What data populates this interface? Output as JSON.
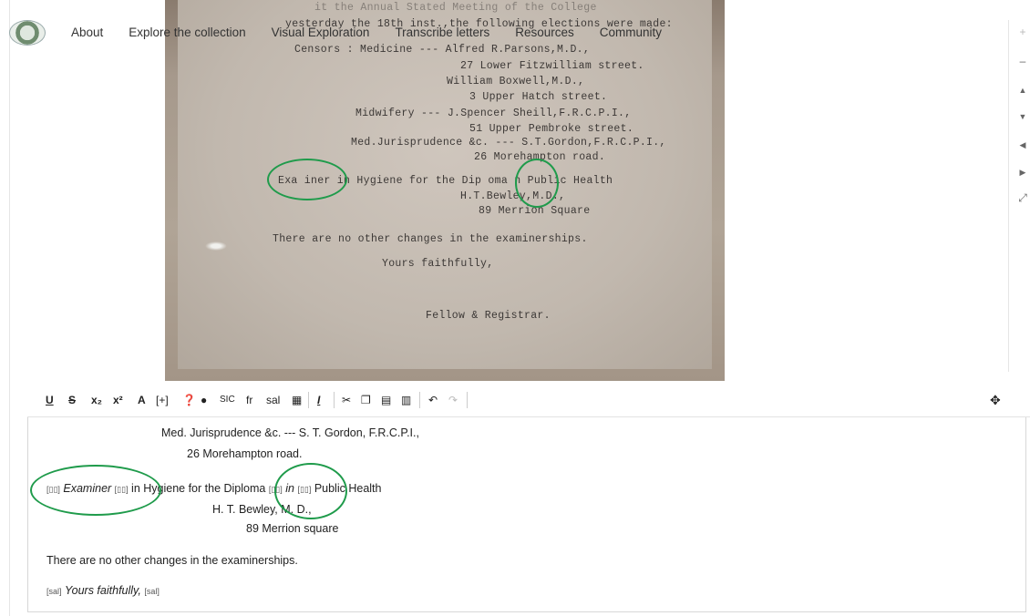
{
  "nav": {
    "items": [
      "About",
      "Explore the collection",
      "Visual Exploration",
      "Transcribe letters",
      "Resources",
      "Community"
    ]
  },
  "document_image": {
    "lines": [
      "it the Annual Stated Meeting of the College",
      "yesterday the 18th inst.,the following elections were made:",
      "Censors : Medicine --- Alfred R.Parsons,M.D.,",
      "27 Lower Fitzwilliam street.",
      "William Boxwell,M.D.,",
      "3 Upper Hatch street.",
      "Midwifery --- J.Spencer Sheill,F.R.C.P.I.,",
      "51 Upper Pembroke street.",
      "Med.Jurisprudence &c. --- S.T.Gordon,F.R.C.P.I.,",
      "26 Morehampton road.",
      "Exa iner in Hygiene for the Dip oma n Public Health",
      "H.T.Bewley,M.D.,",
      "89 Merrion Square",
      "There are no other changes in the examinerships.",
      "Yours faithfully,",
      "Fellow & Registrar."
    ]
  },
  "zoom_tools": {
    "icons": [
      "plus-icon",
      "minus-icon",
      "arrow-up-icon",
      "arrow-down-icon",
      "arrow-left-icon",
      "arrow-right-icon",
      "fullscreen-icon"
    ]
  },
  "editor_toolbar": {
    "underline": "U",
    "strike": "S",
    "subscript": "x₂",
    "superscript": "x²",
    "font": "A",
    "add": "[+]",
    "sic": "SIC",
    "fr": "fr",
    "sal": "sal"
  },
  "transcription": {
    "line1": "Med. Jurisprudence &c. --- S. T. Gordon, F.R.C.P.I.,",
    "line2": "26 Morehampton road.",
    "tag_gap": "[▯▯]",
    "examiner": "Examiner",
    "hygiene": " in Hygiene for the Diploma ",
    "in_word": "in",
    "public_health": " Public Health",
    "line4": "H. T. Bewley, M. D.,",
    "line5": "89 Merrion square",
    "line6": "There are no other changes in the examinerships.",
    "sal_tag": "[sal]",
    "yours": "Yours faithfully,"
  },
  "colors": {
    "annotation_ring": "#1f9b4b"
  }
}
